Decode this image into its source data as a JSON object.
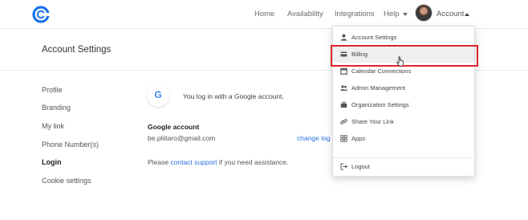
{
  "topbar": {
    "nav": [
      {
        "label": "Home"
      },
      {
        "label": "Availability"
      },
      {
        "label": "Integrations"
      },
      {
        "label": "Help"
      }
    ],
    "account_label": "Account"
  },
  "settings": {
    "title": "Account Settings",
    "sidebar": [
      {
        "label": "Profile"
      },
      {
        "label": "Branding"
      },
      {
        "label": "My link"
      },
      {
        "label": "Phone Number(s)"
      },
      {
        "label": "Login",
        "active": true
      },
      {
        "label": "Cookie settings"
      }
    ],
    "google_letter": "G",
    "google_message": "You log in with a Google account.",
    "account_heading": "Google account",
    "account_email": "be.pliitaro@gmail.com",
    "change_link": "change log",
    "assist_prefix": "Please",
    "assist_link": "contact support",
    "assist_suffix": "if you need assistance."
  },
  "dropdown": {
    "items": [
      {
        "label": "Account Settings",
        "icon": "person-icon"
      },
      {
        "label": "Billing",
        "icon": "credit-card-icon",
        "highlighted": true
      },
      {
        "label": "Calendar Connections",
        "icon": "calendar-icon"
      },
      {
        "label": "Admin Management",
        "icon": "users-icon"
      },
      {
        "label": "Organization Settings",
        "icon": "briefcase-icon"
      },
      {
        "label": "Share Your Link",
        "icon": "link-icon"
      },
      {
        "label": "Apps",
        "icon": "apps-grid-icon"
      },
      {
        "label": "Logout",
        "icon": "logout-icon"
      }
    ]
  },
  "colors": {
    "brand": "#1a73e8",
    "link": "#2a6fdb",
    "highlight_box": "#e0242b"
  }
}
